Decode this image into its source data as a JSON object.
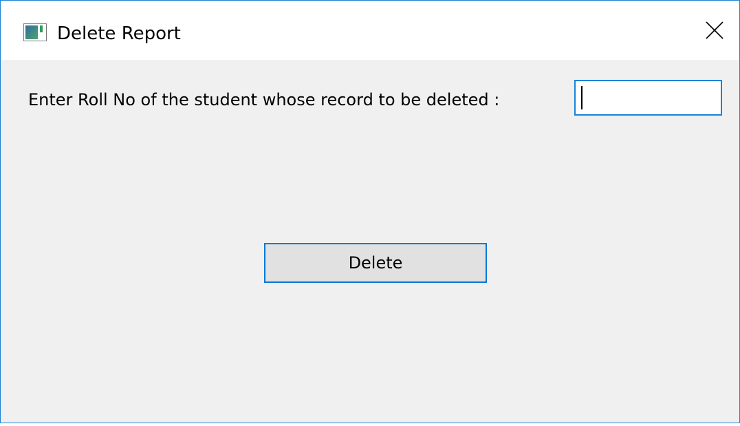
{
  "window": {
    "title": "Delete Report",
    "app_icon": "window-app-icon",
    "close_icon": "close-icon"
  },
  "form": {
    "prompt_label": "Enter Roll No of the student whose record to be deleted :",
    "roll_input_value": "",
    "delete_button_label": "Delete"
  },
  "colors": {
    "accent": "#1883d7",
    "window_bg": "#f0f0f0",
    "button_bg": "#e1e1e1"
  }
}
